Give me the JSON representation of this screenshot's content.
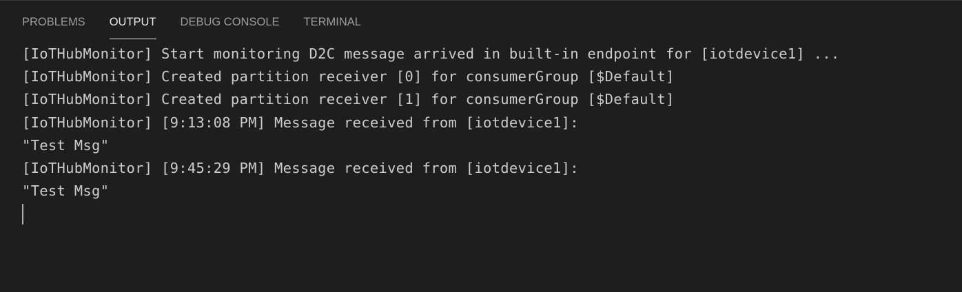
{
  "panel": {
    "tabs": [
      {
        "label": "PROBLEMS",
        "active": false
      },
      {
        "label": "OUTPUT",
        "active": true
      },
      {
        "label": "DEBUG CONSOLE",
        "active": false
      },
      {
        "label": "TERMINAL",
        "active": false
      }
    ]
  },
  "output": {
    "lines": [
      "[IoTHubMonitor] Start monitoring D2C message arrived in built-in endpoint for [iotdevice1] ...",
      "[IoTHubMonitor] Created partition receiver [0] for consumerGroup [$Default]",
      "[IoTHubMonitor] Created partition receiver [1] for consumerGroup [$Default]",
      "[IoTHubMonitor] [9:13:08 PM] Message received from [iotdevice1]:",
      "\"Test Msg\"",
      "[IoTHubMonitor] [9:45:29 PM] Message received from [iotdevice1]:",
      "\"Test Msg\""
    ]
  },
  "colors": {
    "background": "#1e1e1e",
    "text": "#cccccc",
    "tab_inactive": "#9d9d9d",
    "tab_active": "#e7e7e7",
    "cursor": "#aeafad"
  }
}
